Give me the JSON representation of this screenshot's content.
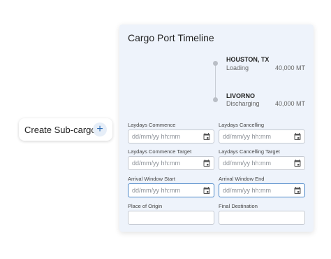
{
  "chip": {
    "label": "Create Sub-cargo",
    "add_icon": "+"
  },
  "panel": {
    "title": "Cargo Port Timeline",
    "stops": [
      {
        "name": "HOUSTON, TX",
        "status": "Loading",
        "quantity": "40,000 MT"
      },
      {
        "name": "LIVORNO",
        "status": "Discharging",
        "quantity": "40,000 MT"
      }
    ],
    "fields": {
      "laydays_commence": {
        "label": "Laydays Commence",
        "placeholder": "dd/mm/yy hh:mm"
      },
      "laydays_cancelling": {
        "label": "Laydays Cancelling",
        "placeholder": "dd/mm/yy hh:mm"
      },
      "laydays_commence_target": {
        "label": "Laydays Commence Target",
        "placeholder": "dd/mm/yy hh:mm"
      },
      "laydays_cancelling_target": {
        "label": "Laydays Cancelling Target",
        "placeholder": "dd/mm/yy hh:mm"
      },
      "arrival_window_start": {
        "label": "Arrival Window Start",
        "placeholder": "dd/mm/yy hh:mm"
      },
      "arrival_window_end": {
        "label": "Arrival Window End",
        "placeholder": "dd/mm/yy hh:mm"
      },
      "place_of_origin": {
        "label": "Place of Origin",
        "value": ""
      },
      "final_destination": {
        "label": "Final Destination",
        "value": ""
      }
    }
  },
  "icons": {
    "calendar": "calendar-icon",
    "add": "plus-icon"
  },
  "colors": {
    "panel_bg": "#eef3fb",
    "accent": "#2d6cb5",
    "active_border": "#4a86c7"
  }
}
